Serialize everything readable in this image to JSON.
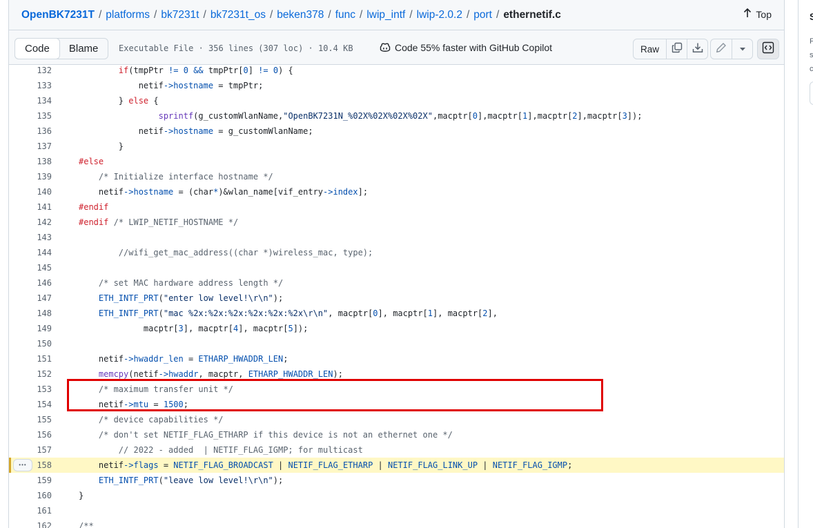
{
  "breadcrumb": {
    "items": [
      "OpenBK7231T",
      "platforms",
      "bk7231t",
      "bk7231t_os",
      "beken378",
      "func",
      "lwip_intf",
      "lwip-2.0.2",
      "port"
    ],
    "file": "ethernetif.c",
    "separator": "/",
    "top_label": "Top"
  },
  "toolbar": {
    "code_tab": "Code",
    "blame_tab": "Blame",
    "file_info": "Executable File · 356 lines (307 loc) · 10.4 KB",
    "copilot_text": "Code 55% faster with GitHub Copilot",
    "raw_label": "Raw"
  },
  "side_panel": {
    "title_initial": "S",
    "text_initials": [
      "F",
      "s",
      "c"
    ]
  },
  "code": {
    "highlighted_line": "158",
    "line_numbers": [
      "132",
      "133",
      "134",
      "135",
      "136",
      "137",
      "138",
      "139",
      "140",
      "141",
      "142",
      "143",
      "144",
      "145",
      "146",
      "147",
      "148",
      "149",
      "150",
      "151",
      "152",
      "153",
      "154",
      "155",
      "156",
      "157",
      "158",
      "159",
      "160",
      "161",
      "162"
    ],
    "lines": [
      {
        "i": "        ",
        "t": [
          [
            "kw",
            "if"
          ],
          [
            "",
            "(tmpPtr "
          ],
          [
            "op",
            "!="
          ],
          [
            "",
            " "
          ],
          [
            "num",
            "0"
          ],
          [
            "",
            " "
          ],
          [
            "op",
            "&&"
          ],
          [
            "",
            " tmpPtr["
          ],
          [
            "num",
            "0"
          ],
          [
            "",
            "] "
          ],
          [
            "op",
            "!="
          ],
          [
            "",
            " "
          ],
          [
            "num",
            "0"
          ],
          [
            "",
            ") {"
          ]
        ]
      },
      {
        "i": "            ",
        "t": [
          [
            "",
            "netif"
          ],
          [
            "op",
            "->"
          ],
          [
            "mem",
            "hostname"
          ],
          [
            "",
            " = tmpPtr;"
          ]
        ]
      },
      {
        "i": "        ",
        "t": [
          [
            "",
            "} "
          ],
          [
            "kw",
            "else"
          ],
          [
            "",
            " {"
          ]
        ]
      },
      {
        "i": "                ",
        "t": [
          [
            "fn",
            "sprintf"
          ],
          [
            "",
            "(g_customWlanName,"
          ],
          [
            "str",
            "\"OpenBK7231N_%02X%02X%02X%02X\""
          ],
          [
            "",
            ",macptr["
          ],
          [
            "num",
            "0"
          ],
          [
            "",
            "],macptr["
          ],
          [
            "num",
            "1"
          ],
          [
            "",
            "],macptr["
          ],
          [
            "num",
            "2"
          ],
          [
            "",
            "],macptr["
          ],
          [
            "num",
            "3"
          ],
          [
            "",
            "]);"
          ]
        ]
      },
      {
        "i": "            ",
        "t": [
          [
            "",
            "netif"
          ],
          [
            "op",
            "->"
          ],
          [
            "mem",
            "hostname"
          ],
          [
            "",
            " = g_customWlanName;"
          ]
        ]
      },
      {
        "i": "        ",
        "t": [
          [
            "",
            "}"
          ]
        ]
      },
      {
        "i": "",
        "t": [
          [
            "pp",
            "#else"
          ]
        ]
      },
      {
        "i": "    ",
        "t": [
          [
            "cm",
            "/* Initialize interface hostname */"
          ]
        ]
      },
      {
        "i": "    ",
        "t": [
          [
            "",
            "netif"
          ],
          [
            "op",
            "->"
          ],
          [
            "mem",
            "hostname"
          ],
          [
            "",
            " = (char"
          ],
          [
            "op",
            "*"
          ],
          [
            "",
            ")&wlan_name[vif_entry"
          ],
          [
            "op",
            "->"
          ],
          [
            "mem",
            "index"
          ],
          [
            "",
            "];"
          ]
        ]
      },
      {
        "i": "",
        "t": [
          [
            "pp",
            "#endif"
          ]
        ]
      },
      {
        "i": "",
        "t": [
          [
            "pp",
            "#endif"
          ],
          [
            "",
            " "
          ],
          [
            "cm",
            "/* LWIP_NETIF_HOSTNAME */"
          ]
        ]
      },
      {
        "i": "",
        "t": []
      },
      {
        "i": "        ",
        "t": [
          [
            "cm",
            "//wifi_get_mac_address((char *)wireless_mac, type);"
          ]
        ]
      },
      {
        "i": "",
        "t": []
      },
      {
        "i": "    ",
        "t": [
          [
            "cm",
            "/* set MAC hardware address length */"
          ]
        ]
      },
      {
        "i": "    ",
        "t": [
          [
            "cst",
            "ETH_INTF_PRT"
          ],
          [
            "",
            "("
          ],
          [
            "str",
            "\"enter low level!\\r\\n\""
          ],
          [
            "",
            ");"
          ]
        ]
      },
      {
        "i": "    ",
        "t": [
          [
            "cst",
            "ETH_INTF_PRT"
          ],
          [
            "",
            "("
          ],
          [
            "str",
            "\"mac %2x:%2x:%2x:%2x:%2x:%2x\\r\\n\""
          ],
          [
            "",
            ", macptr["
          ],
          [
            "num",
            "0"
          ],
          [
            "",
            "], macptr["
          ],
          [
            "num",
            "1"
          ],
          [
            "",
            "], macptr["
          ],
          [
            "num",
            "2"
          ],
          [
            "",
            "],"
          ]
        ]
      },
      {
        "i": "             ",
        "t": [
          [
            "",
            "macptr["
          ],
          [
            "num",
            "3"
          ],
          [
            "",
            "], macptr["
          ],
          [
            "num",
            "4"
          ],
          [
            "",
            "], macptr["
          ],
          [
            "num",
            "5"
          ],
          [
            "",
            "]);"
          ]
        ]
      },
      {
        "i": "",
        "t": []
      },
      {
        "i": "    ",
        "t": [
          [
            "",
            "netif"
          ],
          [
            "op",
            "->"
          ],
          [
            "mem",
            "hwaddr_len"
          ],
          [
            "",
            " = "
          ],
          [
            "cst",
            "ETHARP_HWADDR_LEN"
          ],
          [
            "",
            ";"
          ]
        ]
      },
      {
        "i": "    ",
        "t": [
          [
            "fn",
            "memcpy"
          ],
          [
            "",
            "(netif"
          ],
          [
            "op",
            "->"
          ],
          [
            "mem",
            "hwaddr"
          ],
          [
            "",
            ", macptr, "
          ],
          [
            "cst",
            "ETHARP_HWADDR_LEN"
          ],
          [
            "",
            ");"
          ]
        ]
      },
      {
        "i": "    ",
        "t": [
          [
            "cm",
            "/* maximum transfer unit */"
          ]
        ]
      },
      {
        "i": "    ",
        "t": [
          [
            "",
            "netif"
          ],
          [
            "op",
            "->"
          ],
          [
            "mem",
            "mtu"
          ],
          [
            "",
            " = "
          ],
          [
            "num",
            "1500"
          ],
          [
            "",
            ";"
          ]
        ]
      },
      {
        "i": "    ",
        "t": [
          [
            "cm",
            "/* device capabilities */"
          ]
        ]
      },
      {
        "i": "    ",
        "t": [
          [
            "cm",
            "/* don't set NETIF_FLAG_ETHARP if this device is not an ethernet one */"
          ]
        ]
      },
      {
        "i": "        ",
        "t": [
          [
            "cm",
            "// 2022 - added  | NETIF_FLAG_IGMP; for multicast"
          ]
        ]
      },
      {
        "i": "    ",
        "t": [
          [
            "",
            "netif"
          ],
          [
            "op",
            "->"
          ],
          [
            "mem",
            "flags"
          ],
          [
            "",
            " = "
          ],
          [
            "cst",
            "NETIF_FLAG_BROADCAST"
          ],
          [
            "",
            " | "
          ],
          [
            "cst",
            "NETIF_FLAG_ETHARP"
          ],
          [
            "",
            " | "
          ],
          [
            "cst",
            "NETIF_FLAG_LINK_UP"
          ],
          [
            "",
            " | "
          ],
          [
            "cst",
            "NETIF_FLAG_IGMP"
          ],
          [
            "",
            ";"
          ]
        ]
      },
      {
        "i": "    ",
        "t": [
          [
            "cst",
            "ETH_INTF_PRT"
          ],
          [
            "",
            "("
          ],
          [
            "str",
            "\"leave low level!\\r\\n\""
          ],
          [
            "",
            ");"
          ]
        ]
      },
      {
        "i": "",
        "t": [
          [
            "",
            "}"
          ]
        ]
      },
      {
        "i": "",
        "t": []
      },
      {
        "i": "",
        "t": [
          [
            "cm",
            "/**"
          ]
        ]
      }
    ]
  },
  "icons": {
    "top_arrow": "arrow-up-icon",
    "copilot": "copilot-icon",
    "copy": "copy-icon",
    "download": "download-icon",
    "edit": "pencil-icon",
    "more": "triangle-down-icon",
    "symbols": "code-square-icon",
    "line_menu": "kebab-horizontal-icon"
  },
  "colors": {
    "link": "#0969da",
    "highlight_bg": "#fff8c5",
    "annotation_red": "#e00000",
    "keyword": "#cf222e",
    "constant": "#0550ae",
    "string": "#0a3069",
    "comment": "#59636e"
  }
}
